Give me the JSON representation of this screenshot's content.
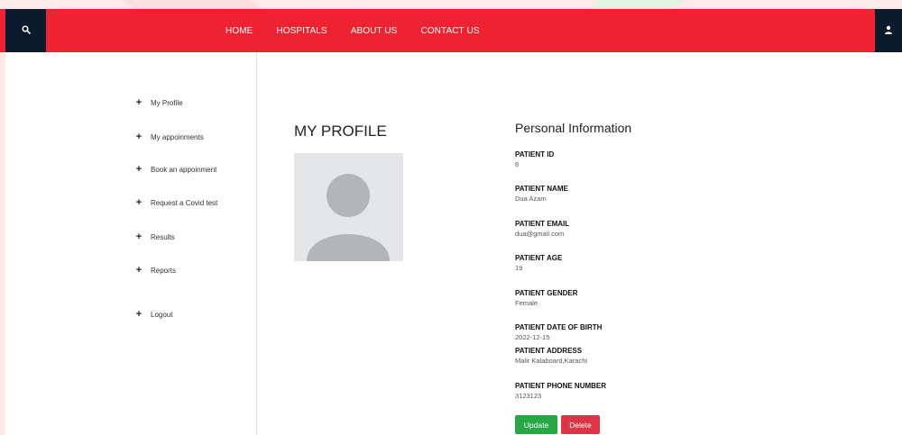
{
  "nav": {
    "items": [
      "HOME",
      "HOSPITALS",
      "ABOUT US",
      "CONTACT US"
    ]
  },
  "icons": {
    "search": "search-icon",
    "user": "user-icon",
    "plus": "plus-icon"
  },
  "colors": {
    "topbar": "#ee2230",
    "dark": "#0c1a2e",
    "update": "#28a745",
    "delete": "#dc3545"
  },
  "sidebar": {
    "items": [
      {
        "label": "My Profile",
        "symbol": "+"
      },
      {
        "label": "My appoinments",
        "symbol": "+"
      },
      {
        "label": "Book an appoinment",
        "symbol": "+"
      },
      {
        "label": "Request a Covid test",
        "symbol": "+"
      },
      {
        "label": "Results",
        "symbol": "+"
      },
      {
        "label": "Reports",
        "symbol": "+"
      },
      {
        "label": "Logout",
        "symbol": "+"
      }
    ]
  },
  "profile": {
    "title": "MY PROFILE",
    "section_title": "Personal Information",
    "fields": [
      {
        "label": "PATIENT ID",
        "value": "8"
      },
      {
        "label": "PATIENT NAME",
        "value": "Dua Azam"
      },
      {
        "label": "PATIENT EMAIL",
        "value": "dua@gmail.com"
      },
      {
        "label": "PATIENT AGE",
        "value": "19"
      },
      {
        "label": "PATIENT GENDER",
        "value": "Female"
      },
      {
        "label": "PATIENT DATE OF BIRTH",
        "value": "2022-12-15"
      },
      {
        "label": "PATIENT ADDRESS",
        "value": "Malir Kalaboard,Karachi"
      },
      {
        "label": "PATIENT PHONE NUMBER",
        "value": "3123123"
      }
    ],
    "update_label": "Update",
    "delete_label": "Delete"
  }
}
